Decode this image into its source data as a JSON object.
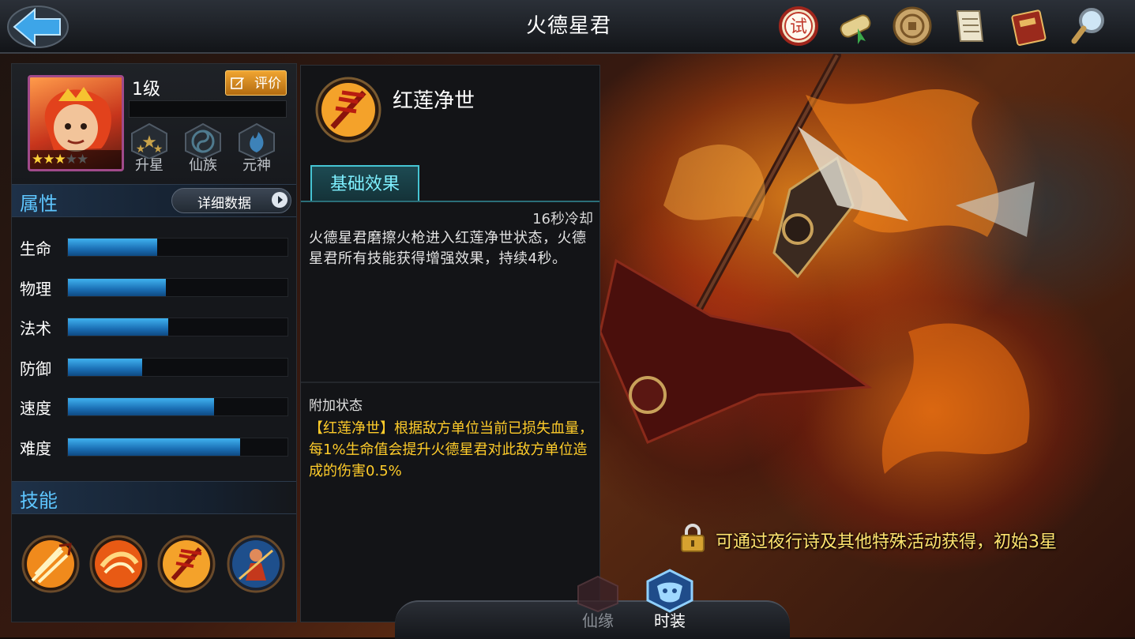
{
  "header": {
    "title": "火德星君",
    "icons": [
      "trial-icon",
      "scroll-icon",
      "coin-icon",
      "document-icon",
      "book-icon",
      "magnifier-icon"
    ],
    "trial_glyph": "试"
  },
  "hero": {
    "level": "1级",
    "rate_label": "评价",
    "stars_on": "★★★",
    "stars_off": "★★",
    "sub_buttons": [
      {
        "label": "升星",
        "icon": "star-upgrade-icon"
      },
      {
        "label": "仙族",
        "icon": "yin-yang-icon"
      },
      {
        "label": "元神",
        "icon": "flame-spirit-icon"
      }
    ]
  },
  "attributes": {
    "title": "属性",
    "detail_label": "详细数据",
    "stats": [
      {
        "name": "生命",
        "fraction": 0.41
      },
      {
        "name": "物理",
        "fraction": 0.45
      },
      {
        "name": "法术",
        "fraction": 0.46
      },
      {
        "name": "防御",
        "fraction": 0.34
      },
      {
        "name": "速度",
        "fraction": 0.67
      },
      {
        "name": "难度",
        "fraction": 0.79
      }
    ]
  },
  "skills": {
    "title": "技能",
    "icons": [
      "trident-fire-skill-icon",
      "fire-slash-skill-icon",
      "red-lotus-skill-icon",
      "fire-warrior-skill-icon"
    ]
  },
  "skill_detail": {
    "name": "红莲净世",
    "tab_label": "基础效果",
    "cooldown": "16秒冷却",
    "description": "火德星君磨擦火枪进入红莲净世状态，火德星君所有技能获得增强效果，持续4秒。",
    "extra_title": "附加状态",
    "extra_description": "【红莲净世】根据敌方单位当前已损失血量，每1%生命值会提升火德星君对此敌方单位造成的伤害0.5%"
  },
  "bottom_tabs": [
    {
      "label": "仙缘",
      "active": false
    },
    {
      "label": "时装",
      "active": true
    }
  ],
  "unlock_notice": "可通过夜行诗及其他特殊活动获得，初始3星",
  "colors": {
    "accent_blue": "#5ec6ff",
    "tab_cyan": "#7ef0ff",
    "notice_yellow": "#ffe36e",
    "extra_yellow": "#ffcc2a",
    "stat_bar": "#1b6fb5"
  }
}
